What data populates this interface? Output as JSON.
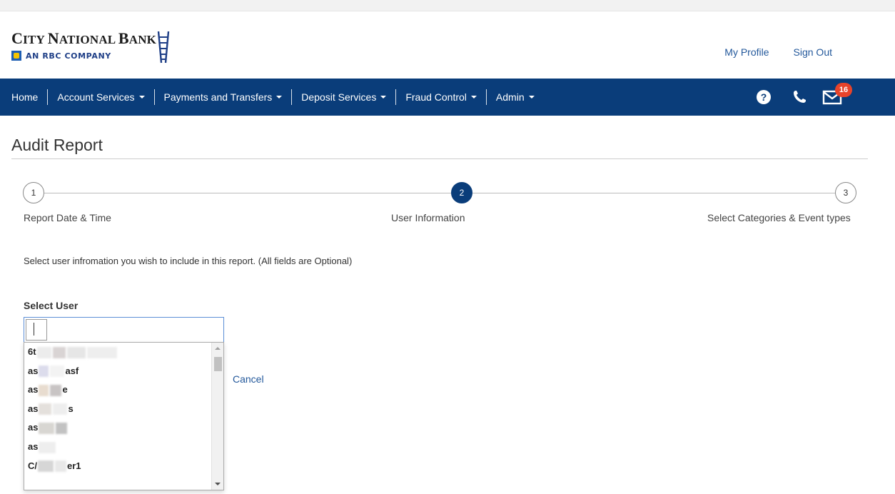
{
  "header": {
    "logo_city": "C",
    "logo_ity": "ITY ",
    "logo_national": "N",
    "logo_ational": "ATIONAL ",
    "logo_bank": "B",
    "logo_ank": "ANK",
    "logo_sub": "AN RBC COMPANY",
    "links": {
      "profile": "My Profile",
      "signout": "Sign Out"
    }
  },
  "nav": {
    "items": [
      {
        "label": "Home",
        "dropdown": false
      },
      {
        "label": "Account Services",
        "dropdown": true
      },
      {
        "label": "Payments and Transfers",
        "dropdown": true
      },
      {
        "label": "Deposit Services",
        "dropdown": true
      },
      {
        "label": "Fraud Control",
        "dropdown": true
      },
      {
        "label": "Admin",
        "dropdown": true
      }
    ],
    "icons": {
      "help": "question-circle-icon",
      "phone": "phone-icon",
      "mail": "envelope-icon"
    },
    "mail_badge": "16",
    "help_glyph": "?"
  },
  "page": {
    "title": "Audit Report"
  },
  "stepper": {
    "steps": [
      {
        "number": "1",
        "label": "Report Date & Time",
        "active": false
      },
      {
        "number": "2",
        "label": "User Information",
        "active": true
      },
      {
        "number": "3",
        "label": "Select Categories & Event types",
        "active": false
      }
    ]
  },
  "form": {
    "instructions": "Select user infromation you wish to include in this report. (All fields are Optional)",
    "select_user_label": "Select User",
    "search_value": "",
    "dropdown_items": [
      {
        "prefix": "6t",
        "suffix": ""
      },
      {
        "prefix": "as",
        "suffix": "asf"
      },
      {
        "prefix": "as",
        "suffix": "e"
      },
      {
        "prefix": "as",
        "suffix": "s"
      },
      {
        "prefix": "as",
        "suffix": ""
      },
      {
        "prefix": "as",
        "suffix": ""
      },
      {
        "prefix": "C/",
        "suffix": "er1"
      }
    ],
    "cancel_label": "Cancel"
  },
  "colors": {
    "navy": "#0a3d7a",
    "link": "#23589b",
    "badge": "#e8432a"
  }
}
